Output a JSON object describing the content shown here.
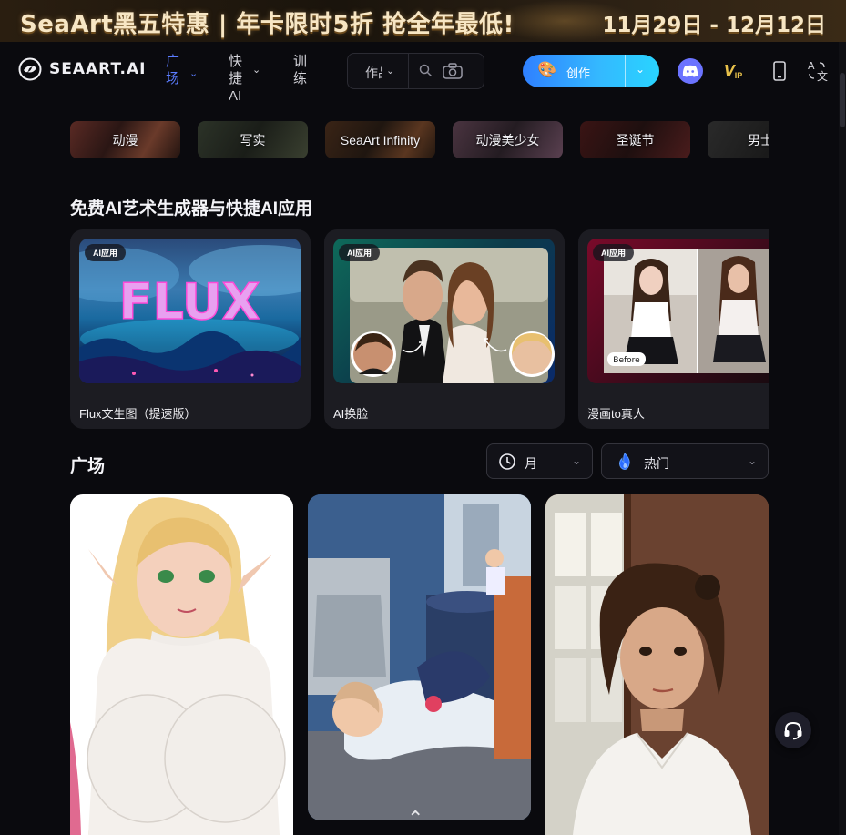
{
  "banner": {
    "headline": "SeaArt黑五特惠 | 年卡限时5折 抢全年最低!",
    "dates": "11月29日 - 12月12日"
  },
  "header": {
    "logo_text": "SEAART.AI",
    "nav": {
      "plaza": "广场",
      "quick_ai": "快捷AI",
      "train": "训练"
    },
    "search": {
      "mode_label": "作品"
    },
    "create_label": "创作"
  },
  "chips": [
    "动漫",
    "写实",
    "SeaArt Infinity",
    "动漫美少女",
    "圣诞节",
    "男士"
  ],
  "apps_section": {
    "title": "免费AI艺术生成器与快捷AI应用",
    "cards": [
      {
        "badge": "AI应用",
        "title": "Flux文生图（提速版）",
        "thumb_text": "FLUX"
      },
      {
        "badge": "AI应用",
        "title": "AI换脸"
      },
      {
        "badge": "AI应用",
        "title": "漫画to真人",
        "thumb_text": "Before"
      }
    ]
  },
  "plaza_section": {
    "title": "广场",
    "filters": {
      "period": "月",
      "sort": "热门"
    }
  },
  "colors": {
    "accent": "#5b7cff",
    "create_gradient_start": "#2f80ff",
    "create_gradient_end": "#29d4ff",
    "background": "#0a0a0e",
    "discord": "#6b73ff"
  },
  "icons": {
    "search": "search-icon",
    "camera": "camera-icon",
    "palette": "palette-icon",
    "discord": "discord-icon",
    "vip": "vip-icon",
    "phone": "phone-icon",
    "translate": "translate-icon",
    "clock": "clock-icon",
    "flame": "flame-icon",
    "support": "headset-icon"
  }
}
